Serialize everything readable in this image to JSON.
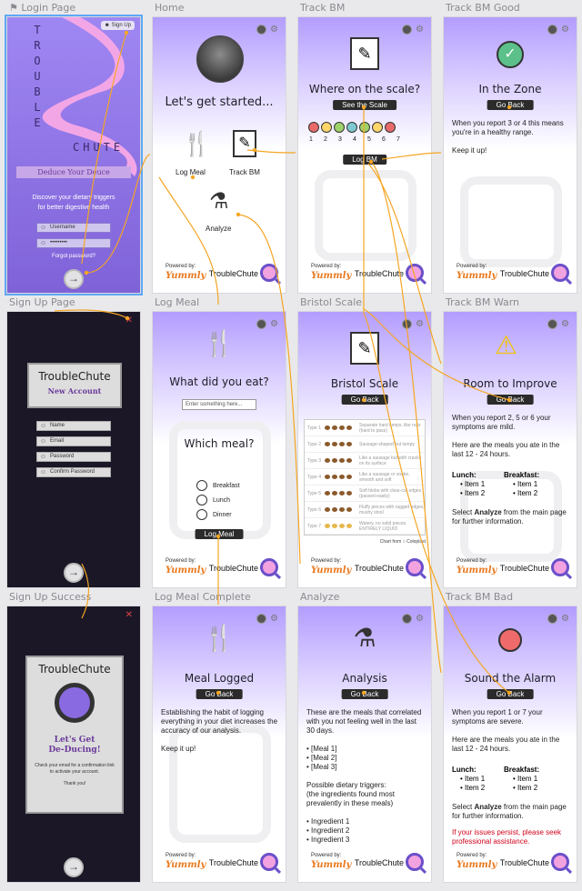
{
  "labels": {
    "login": "Login Page",
    "home": "Home",
    "track": "Track BM",
    "good": "Track BM Good",
    "signup": "Sign Up Page",
    "logmeal": "Log Meal",
    "bristol": "Bristol Scale",
    "warn": "Track BM Warn",
    "signupsuccess": "Sign Up Success",
    "mealcomplete": "Log Meal Complete",
    "analyze": "Analyze",
    "bad": "Track BM Bad"
  },
  "footer": {
    "powered": "Powered by:",
    "yummly": "Yummly",
    "brand": "TroubleChute"
  },
  "login": {
    "signup_btn": "Sign Up",
    "word1": [
      "T",
      "R",
      "O",
      "U",
      "B",
      "L",
      "E"
    ],
    "word2": "CHUTE",
    "tagline": "Deduce Your Deuce",
    "desc": "Discover your dietary triggers\nfor better digestive health",
    "username": "Username",
    "password": "•••••••••",
    "forgot": "Forgot password?",
    "enter": "→"
  },
  "home": {
    "heading": "Let's get started...",
    "log_meal": "Log Meal",
    "track_bm": "Track BM",
    "analyze": "Analyze"
  },
  "track": {
    "heading": "Where on the scale?",
    "see_scale": "See the Scale",
    "numbers": [
      "1",
      "2",
      "3",
      "4",
      "5",
      "6",
      "7"
    ],
    "dot_colors": [
      "#e86a6a",
      "#ffd66a",
      "#9ed36a",
      "#7ec9d2",
      "#9ed36a",
      "#ffd66a",
      "#e86a6a"
    ],
    "log_bm": "Log BM"
  },
  "good": {
    "heading": "In the Zone",
    "go_back": "Go Back",
    "text": "When you report 3 or 4 this means you're in a healthy range.\n\nKeep it up!"
  },
  "signup": {
    "brand": "TroubleChute",
    "sub": "New Account",
    "fields": [
      "Name",
      "Email",
      "Password",
      "Confirm Password"
    ],
    "enter": "→",
    "close": "✕"
  },
  "logmeal": {
    "heading": "What did you eat?",
    "placeholder": "Enter something here...",
    "which": "Which meal?",
    "options": [
      "Breakfast",
      "Lunch",
      "Dinner"
    ],
    "button": "Log Meal"
  },
  "bristol": {
    "heading": "Bristol Scale",
    "go_back": "Go Back",
    "types": [
      "Type 1",
      "Type 2",
      "Type 3",
      "Type 4",
      "Type 5",
      "Type 6",
      "Type 7"
    ],
    "descs": [
      "Separate hard lumps, like nuts (hard to pass)",
      "Sausage-shaped but lumpy",
      "Like a sausage but with cracks on its surface",
      "Like a sausage or snake, smooth and soft",
      "Soft blobs with clear-cut edges (passed easily)",
      "Fluffy pieces with ragged edges, mushy stool",
      "Watery, no solid pieces. ENTIRELY LIQUID"
    ],
    "credit": "Chart from",
    "credit_brand": "Coloplast"
  },
  "warn": {
    "heading": "Room to Improve",
    "go_back": "Go Back",
    "text": "When you report 2, 5 or 6 your symptoms are mild.\n\nHere are the meals you ate in the last 12 - 24 hours.",
    "lunch": "Lunch:",
    "breakfast": "Breakfast:",
    "items": [
      "• Item 1",
      "• Item 2"
    ],
    "select_a": "Select ",
    "select_b": "Analyze",
    "select_c": " from the main page for further information."
  },
  "signupsuccess": {
    "brand": "TroubleChute",
    "headline": "Let's Get\nDe-Ducing!",
    "text": "Check your email for a confirmation link to activate your account.",
    "thanks": "Thank you!",
    "enter": "→",
    "close": "✕"
  },
  "mealcomplete": {
    "heading": "Meal Logged",
    "go_back": "Go Back",
    "text": "Establishing the habit of logging everything in your diet increases the accuracy of our analysis.\n\nKeep it up!"
  },
  "analyze": {
    "heading": "Analysis",
    "go_back": "Go Back",
    "text": "These are the meals that correlated with you not feeling well in the last 30 days.\n\n• [Meal 1]\n• [Meal 2]\n• [Meal 3]\n\nPossible dietary triggers:\n(the ingredients found most prevalently in these meals)\n\n• Ingredient 1\n• Ingredient 2\n• Ingredient 3"
  },
  "bad": {
    "heading": "Sound the Alarm",
    "go_back": "Go Back",
    "text": "When you report 1 or 7 your symptoms are severe.\n\nHere are the meals you ate in the last 12 - 24 hours.",
    "lunch": "Lunch:",
    "breakfast": "Breakfast:",
    "items": [
      "• Item 1",
      "• Item 2"
    ],
    "select_a": "Select ",
    "select_b": "Analyze",
    "select_c": " from the main page for further information.",
    "warning": "If your issues persist, please seek professional assistance.",
    "warning_color": "#d0021b"
  },
  "colors": {
    "accent": "#f5a623",
    "purple": "#6a4fc9",
    "dark": "#1b1726"
  }
}
